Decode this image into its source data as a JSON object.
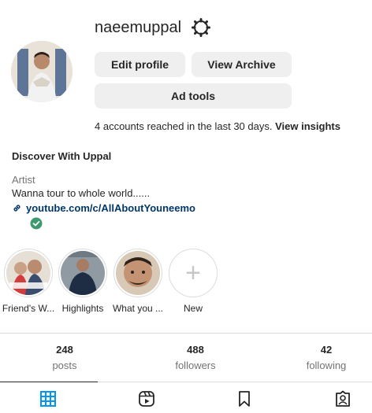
{
  "profile": {
    "username": "naeemuppal",
    "full_name": "Discover With Uppal",
    "category": "Artist",
    "bio": "Wanna tour to whole world......",
    "link": "youtube.com/c/AllAboutYouneemo"
  },
  "buttons": {
    "edit_profile": "Edit profile",
    "view_archive": "View Archive",
    "ad_tools": "Ad tools"
  },
  "insights": {
    "text": "4 accounts reached in the last 30 days.",
    "link": "View insights"
  },
  "highlights": [
    {
      "label": "Friend's W..."
    },
    {
      "label": "Highlights"
    },
    {
      "label": "What you ..."
    },
    {
      "label": "New"
    }
  ],
  "stats": [
    {
      "value": "248",
      "label": "posts"
    },
    {
      "value": "488",
      "label": "followers"
    },
    {
      "value": "42",
      "label": "following"
    }
  ],
  "tabs": {
    "active": "posts-grid",
    "icons": [
      "grid-icon",
      "reels-icon",
      "saved-icon",
      "tagged-icon"
    ]
  },
  "colors": {
    "accent_blue": "#0095f6",
    "link_blue": "#00376b",
    "verified_green": "#3d9970",
    "button_gray": "#efefef"
  }
}
